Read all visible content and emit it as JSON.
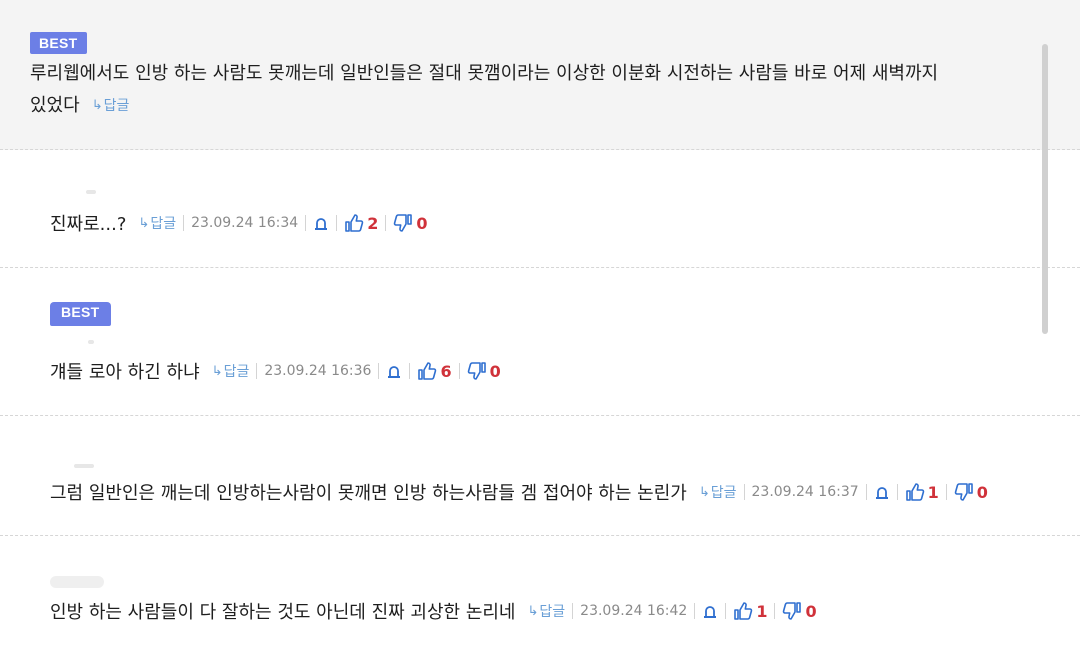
{
  "labels": {
    "best": "BEST",
    "reply": "답글",
    "reply_arrow": "↳"
  },
  "comments": [
    {
      "text_line1": "루리웹에서도 인방 하는 사람도 못깨는데 일반인들은 절대 못깸이라는 이상한 이분화 시전하는 사람들 바로 어제 새벽까지",
      "text_line2": "있었다"
    },
    {
      "text": "진짜로...?",
      "date": "23.09.24 16:34",
      "likes": "2",
      "dislikes": "0"
    },
    {
      "text": "걔들 로아 하긴 하냐",
      "date": "23.09.24 16:36",
      "likes": "6",
      "dislikes": "0"
    },
    {
      "text": "그럼 일반인은 깨는데 인방하는사람이 못깨면 인방 하는사람들 겜 접어야 하는 논린가",
      "date": "23.09.24 16:37",
      "likes": "1",
      "dislikes": "0"
    },
    {
      "text": "인방 하는 사람들이 다 잘하는 것도 아닌데 진짜 괴상한 논리네",
      "date": "23.09.24 16:42",
      "likes": "1",
      "dislikes": "0"
    }
  ],
  "colors": {
    "best_badge": "#6c7fe6",
    "reply_link": "#6a9fd6",
    "vote_count": "#d0323a",
    "vote_icon": "#2f6fd0",
    "highlight_bg": "#f4f4f4"
  },
  "icons": {
    "report": "siren-icon",
    "like": "thumbs-up-icon",
    "dislike": "thumbs-down-icon"
  }
}
